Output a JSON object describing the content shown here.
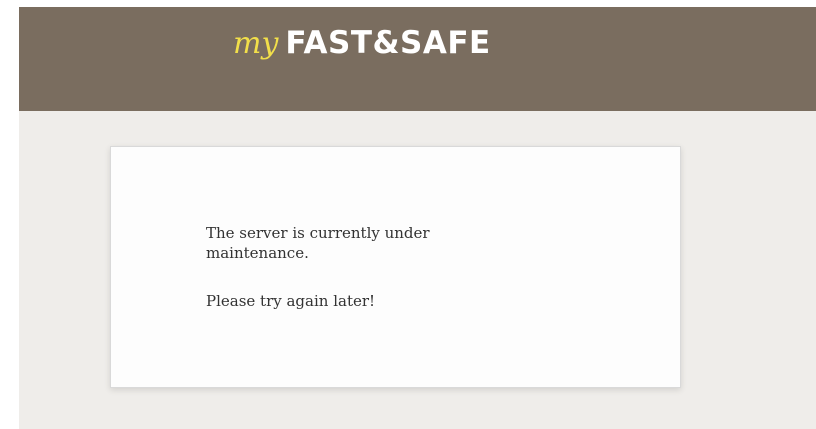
{
  "header": {
    "logo_prefix": "my",
    "logo_brand": "FAST&SAFE",
    "background_color": "#7a6d5f",
    "prefix_color": "#f2df4a"
  },
  "message": {
    "line1": "The server is currently under maintenance.",
    "line2": "Please try again later!"
  }
}
